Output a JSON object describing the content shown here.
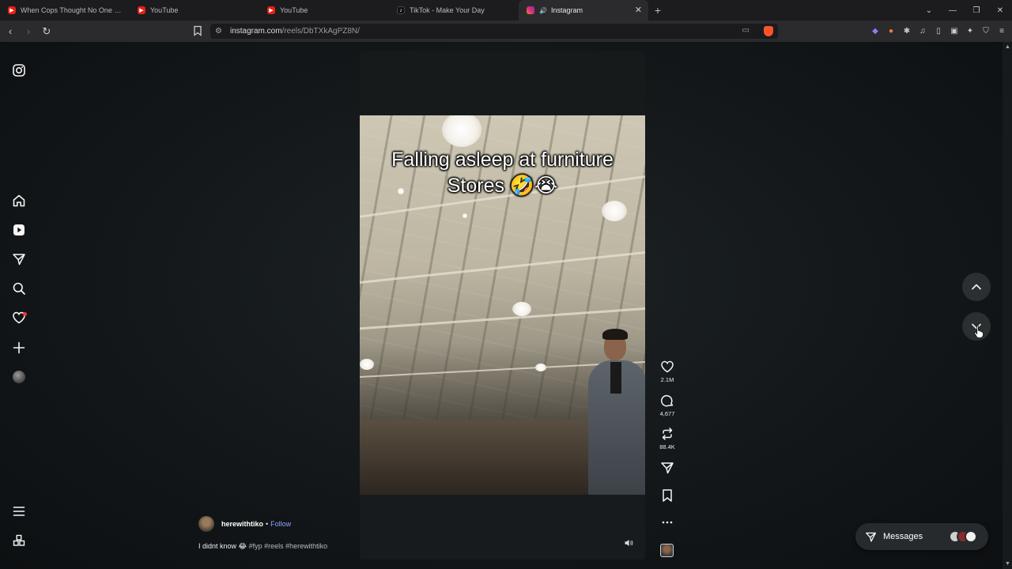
{
  "browser": {
    "tabs": [
      {
        "label": "When Cops Thought No One Was W",
        "favicon": "youtube-icon",
        "active": false
      },
      {
        "label": "YouTube",
        "favicon": "youtube-icon",
        "active": false
      },
      {
        "label": "YouTube",
        "favicon": "youtube-icon",
        "active": false
      },
      {
        "label": "TikTok - Make Your Day",
        "favicon": "tiktok-icon",
        "active": false
      },
      {
        "label": "Instagram",
        "favicon": "instagram-icon",
        "active": true
      }
    ],
    "new_tab_symbol": "+",
    "url_host": "instagram.com",
    "url_path": "/reels/DbTXkAgPZ8N/"
  },
  "reel": {
    "overlay_line1": "Falling asleep at furniture",
    "overlay_line2": "Stores 🤣😭",
    "author": "herewithtiko",
    "separator": "•",
    "follow_label": "Follow",
    "caption_text": "I didnt know 😂",
    "caption_tags": "#fyp #reels #herewithtiko",
    "likes": "2.1M",
    "comments": "4,677",
    "reposts": "88.4K"
  },
  "messages": {
    "label": "Messages"
  },
  "colors": {
    "accent_link": "#8aa4ff",
    "notification": "#ff3040",
    "youtube": "#e62117"
  }
}
